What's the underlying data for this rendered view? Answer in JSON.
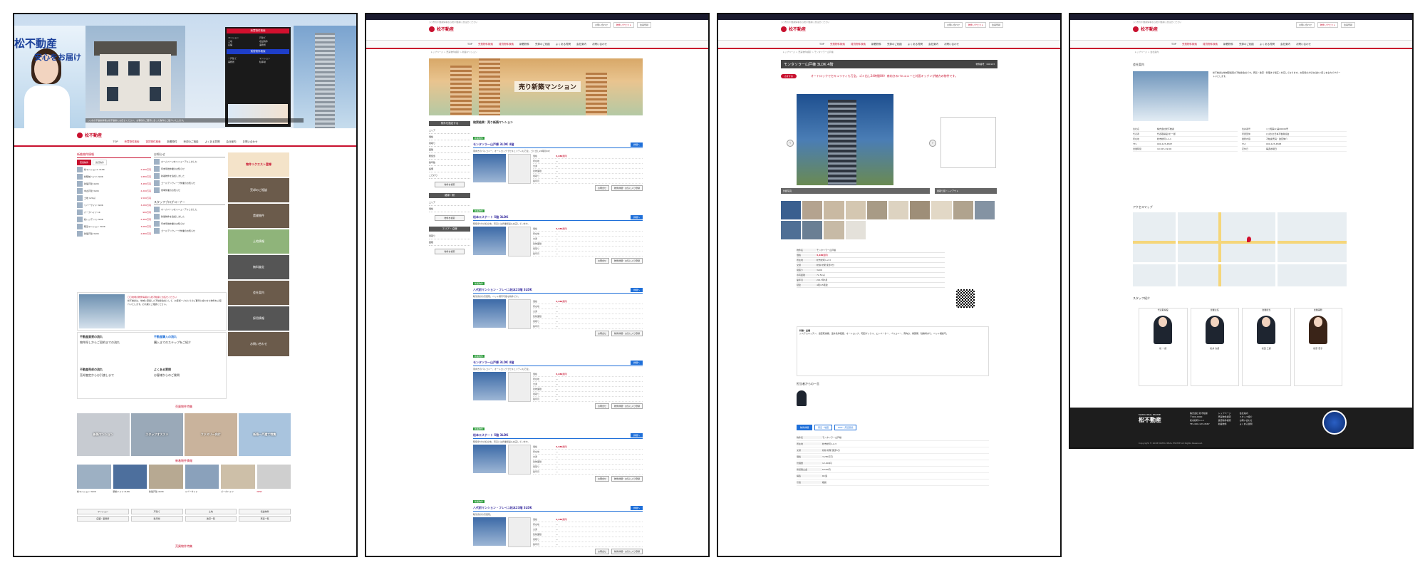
{
  "site": {
    "brand": "松不動産",
    "brand_en": "MATSU REAL ESTATE",
    "tagline": "○○市の不動産情報なら松不動産にお任せください",
    "top_links": [
      "お問い合わせ",
      "物件リクエスト",
      "会員登録"
    ],
    "nav": [
      "TOP",
      "売買物件検索",
      "賃貸物件検索",
      "新着物件",
      "売却のご相談",
      "よくある質問",
      "会社案内",
      "お問い合わせ"
    ]
  },
  "panel1": {
    "hero": {
      "title": "松不動産",
      "subtitle": "安心をお届け",
      "caption": "○○市の不動産情報は松不動産にお任せください。お客様のご要望に合った物件をご紹介いたします。",
      "menu_header_buy": "売買物件検索",
      "menu_header_rent": "賃貸物件検索",
      "menu_buy": [
        "マンション",
        "戸建て",
        "土地",
        "収益物件",
        "店舗",
        "事務所"
      ],
      "menu_rent": [
        "一戸建て",
        "マンション",
        "事務所",
        "駐車場"
      ]
    },
    "new_listings_title": "新着物件情報",
    "tabs": [
      "売買物件",
      "賃貸物件"
    ],
    "new_listings": [
      {
        "text": "松マンションA 3LDK",
        "price": "2,980万円"
      },
      {
        "text": "松駅前ハイツ 2LDK",
        "price": "1,880万円"
      },
      {
        "text": "新築戸建 4LDK",
        "price": "3,480万円"
      },
      {
        "text": "中古戸建 3LDK",
        "price": "2,200万円"
      },
      {
        "text": "土地 120㎡",
        "price": "1,500万円"
      },
      {
        "text": "リバーサイド 3LDK",
        "price": "3,280万円"
      },
      {
        "text": "パークハイツ 1K",
        "price": "980万円"
      },
      {
        "text": "松レジデンス 2LDK",
        "price": "2,480万円"
      },
      {
        "text": "駅近マンション 3LDK",
        "price": "3,680万円"
      },
      {
        "text": "新築戸建 3LDK",
        "price": "2,880万円"
      }
    ],
    "news_title": "お知らせ",
    "news": [
      "ホームページをリニューアルしました",
      "年末年始休業のお知らせ",
      "新着物件を追加しました",
      "ゴールデンウィーク休業のお知らせ",
      "夏季休業のお知らせ"
    ],
    "staff_blog_title": "スタッフブログコーナー",
    "side_buttons": [
      "物件リクエスト登録",
      "売却のご相談",
      "賃貸物件",
      "土地情報",
      "無料査定",
      "会社案内",
      "採用情報",
      "お問い合わせ"
    ],
    "company_title": "〇〇地域の物件情報なら松不動産にお任せください",
    "company_text": "松不動産は、地域に密着した不動産会社として、お客様一人ひとりのご要望に合わせた物件をご紹介いたします。お気軽にご相談ください。",
    "flow": [
      {
        "title": "不動産賃貸の流れ",
        "text": "物件探しからご契約までの流れ"
      },
      {
        "title": "不動産購入の流れ",
        "text": "購入までのステップをご紹介"
      },
      {
        "title": "不動産売却の流れ",
        "text": "売却査定からお引渡しまで"
      },
      {
        "title": "よくある質問",
        "text": "お客様からのご質問"
      }
    ],
    "pickup_title": "売買物件特集",
    "pickup": [
      "新築マンション",
      "スタッフオススメ",
      "ファミリー向け",
      "新築一戸建て特集"
    ],
    "new_section_title": "新着物件情報",
    "new_cards": [
      "松マンション 3LDK",
      "駅前ハイツ 2LDK",
      "新築戸建 4LDK",
      "リバーサイド",
      "パークハイツ",
      "NEW"
    ],
    "btns1": [
      "マンション",
      "戸建て",
      "土地",
      "収益物件"
    ],
    "btns2": [
      "店舗・事務所",
      "駐車場",
      "賃貸一覧",
      "売買一覧"
    ],
    "bottom_title": "売買物件特集"
  },
  "panel2": {
    "breadcrumb": "トップページ > 売買物件検索 > 新築マンション",
    "banner_text": "売り新築マンション",
    "search_header_1": "条件を指定する",
    "search_items_1": [
      "エリア",
      "価格",
      "間取り",
      "面積",
      "駅徒歩",
      "築年数",
      "設備",
      "こだわり"
    ],
    "search_header_2": "路線・駅",
    "search_header_3": "エリア・沿線",
    "search_btn": "物件を検索",
    "result_title": "検索結果：売り新築マンション",
    "listings": [
      {
        "badge": "新着物件",
        "title": "モンタソラー山戸棟 3LDK 4階",
        "price": "3,280万円",
        "desc": "南向きのバルコニー、オートロックでセキュリティも万全。ゴミ出し24時間OK！"
      },
      {
        "badge": "新着物件",
        "title": "松本エステート 5階 3LDK",
        "price": "3,480万円",
        "desc": "駅徒歩5分の好立地。周辺には商業施設も充実しています。"
      },
      {
        "badge": "新着物件",
        "title": "八代前マンション・フレイユ松本23階 3LDK",
        "price": "3,480万円",
        "desc": "眺望良好の高層階。ペット飼育可能な物件です。"
      },
      {
        "badge": "新着物件",
        "title": "モンタソラー山戸棟 3LDK 4階",
        "price": "3,280万円",
        "desc": "南向きのバルコニー、オートロックでセキュリティも万全。"
      },
      {
        "badge": "新着物件",
        "title": "松本エステート 5階 3LDK",
        "price": "3,480万円",
        "desc": "駅徒歩5分の好立地。周辺には商業施設も充実しています。"
      },
      {
        "badge": "新着物件",
        "title": "八代前マンション・フレイユ松本23階 3LDK",
        "price": "3,480万円",
        "desc": "眺望良好の高層階。"
      }
    ],
    "table_labels": [
      "価格",
      "所在地",
      "交通",
      "建物面積",
      "間取り",
      "築年月"
    ],
    "detail_btn": "詳細へ",
    "card_btns": [
      "お問合せ",
      "物件詳細・お気に入り登録"
    ]
  },
  "panel3": {
    "breadcrumb": "トップページ > 売買物件検索 > モンタソラー山戸棟",
    "title": "モンタソラー山戸棟 3LDK 4階",
    "title_meta": "物件番号：000123",
    "pickup_tag": "おすすめ",
    "pickup_text": "オートロックでセキュリティも万全。ゴミ出し24時間OK！南向きのバルコニーと対面キッチンが魅力の物件です。",
    "caption_left": "外観写真",
    "caption_right": "間取り図・レイアウト",
    "detail_rows": [
      {
        "label": "物件名",
        "value": "モンタソラー山戸棟"
      },
      {
        "label": "価格",
        "value": "3,280万円"
      },
      {
        "label": "所在地",
        "value": "松市松町1-2-3"
      },
      {
        "label": "交通",
        "value": "松線 松駅 徒歩5分"
      },
      {
        "label": "間取り",
        "value": "3LDK"
      },
      {
        "label": "専有面積",
        "value": "72.50㎡"
      },
      {
        "label": "築年月",
        "value": "2017年3月"
      },
      {
        "label": "階建",
        "value": "4階/15階建"
      }
    ],
    "feature_title": "特徴・設備",
    "feature_text": "システムキッチン、浴室乾燥機、温水洗浄便座、オートロック、宅配ボックス、エレベーター、バルコニー、南向き、角部屋、駐輪場あり、ペット相談可。",
    "staff_title": "担当者からの一言",
    "tabs": [
      "物件詳細",
      "周辺・地図",
      "MAP・周辺環境"
    ],
    "bottom_rows": [
      {
        "label": "物件名",
        "value": "モンタソラー山戸棟"
      },
      {
        "label": "所在地",
        "value": "松市松町1-2-3"
      },
      {
        "label": "交通",
        "value": "松線 松駅 徒歩5分"
      },
      {
        "label": "価格",
        "value": "3,280万円"
      },
      {
        "label": "管理費",
        "value": "12,000円"
      },
      {
        "label": "修繕積立金",
        "value": "8,500円"
      },
      {
        "label": "構造",
        "value": "RC造"
      },
      {
        "label": "引渡",
        "value": "相談"
      }
    ]
  },
  "panel4": {
    "breadcrumb": "トップページ > 会社案内",
    "section_company": "会社案内",
    "company_text": "松不動産は地域密着型の不動産会社です。売買・賃貸・管理まで幅広く対応しております。お客様の大切な住まい探しを全力でサポートいたします。",
    "info_rows": [
      {
        "label": "会社名",
        "value": "株式会社松不動産"
      },
      {
        "label": "代表者",
        "value": "代表取締役 松 一郎"
      },
      {
        "label": "所在地",
        "value": "松市松町1-1-1"
      },
      {
        "label": "TEL",
        "value": "000-123-4567"
      },
      {
        "label": "FAX",
        "value": "000-123-4568"
      },
      {
        "label": "営業時間",
        "value": "10:00〜19:00"
      },
      {
        "label": "定休日",
        "value": "毎週水曜日"
      },
      {
        "label": "免許番号",
        "value": "○○知事(1)第00000号"
      },
      {
        "label": "所属団体",
        "value": "(公社)全日本不動産協会"
      },
      {
        "label": "業務内容",
        "value": "不動産売買・賃貸仲介"
      }
    ],
    "section_map": "アクセスマップ",
    "section_staff": "スタッフ紹介",
    "staff": [
      {
        "role": "代表取締役",
        "name": "松 一郎"
      },
      {
        "role": "営業主任",
        "name": "松井 次郎"
      },
      {
        "role": "営業担当",
        "name": "松田 三郎"
      },
      {
        "role": "営業事務",
        "name": "松原 花子"
      }
    ],
    "footer_cols": [
      [
        "株式会社 松不動産",
        "〒000-0000",
        "松市松町1-1-1",
        "TEL 000-123-4567"
      ],
      [
        "トップページ",
        "売買物件検索",
        "賃貸物件検索",
        "新着物件"
      ],
      [
        "会社案内",
        "スタッフ紹介",
        "お問い合わせ",
        "よくある質問"
      ]
    ],
    "copyright": "Copyright © 2018 MATSU REAL ESTATE All Rights Reserved."
  }
}
